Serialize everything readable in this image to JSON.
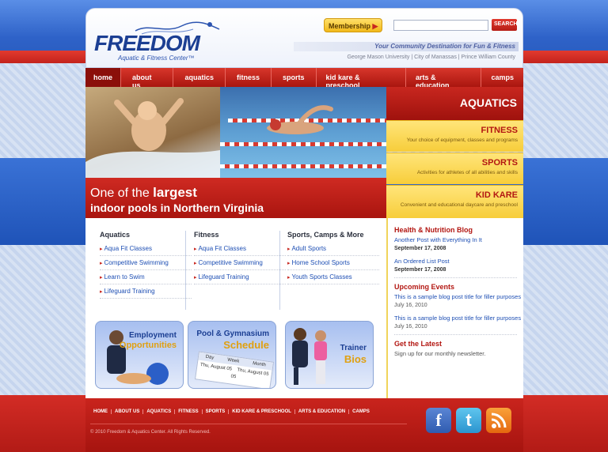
{
  "header": {
    "logo_text": "FREEDOM",
    "logo_subtitle": "Aquatic & Fitness Center™",
    "membership_label": "Membership",
    "search_placeholder": "",
    "search_button": "SEARCH",
    "tagline": "Your Community Destination for Fun & Fitness",
    "locations": "George Mason University | City of Manassas | Prince William County"
  },
  "nav": {
    "items": [
      "home",
      "about us",
      "aquatics",
      "fitness",
      "sports",
      "kid kare & preschool",
      "arts & education",
      "camps"
    ]
  },
  "hero": {
    "line1_prefix": "One of the ",
    "line1_bold": "largest",
    "line2": "indoor pools in Northern Virginia"
  },
  "promos": {
    "aquatics": "AQUATICS",
    "items": [
      {
        "title": "FITNESS",
        "desc": "Your choice of equipment, classes and programs"
      },
      {
        "title": "SPORTS",
        "desc": "Activities for athletes of all abilities and skills"
      },
      {
        "title": "KID KARE",
        "desc": "Convenient and educational daycare and preschool"
      }
    ]
  },
  "columns": [
    {
      "title": "Aquatics",
      "links": [
        "Aqua Fit Classes",
        "Competitive Swimming",
        "Learn to Swim",
        "Lifeguard Training"
      ]
    },
    {
      "title": "Fitness",
      "links": [
        "Aqua Fit Classes",
        "Competitive Swimming",
        "Lifeguard Training"
      ]
    },
    {
      "title": "Sports, Camps & More",
      "links": [
        "Adult Sports",
        "Home School Sports",
        "Youth Sports Classes"
      ]
    }
  ],
  "tiles": {
    "employment": {
      "title": "Employment",
      "sub": "Opportunities"
    },
    "schedule": {
      "title": "Pool & Gymnasium",
      "sub": "Schedule",
      "cal_day": "Day",
      "cal_week": "Week",
      "cal_month": "Month",
      "cal_date1": "Thu, August 05",
      "cal_date2": "Thu, August 05",
      "cal_num": "05"
    },
    "trainer": {
      "title": "Trainer",
      "sub": "Bios"
    }
  },
  "sidebar": {
    "blog_title": "Health & Nutrition Blog",
    "posts": [
      {
        "title": "Another Post with Everything In It",
        "date": "September 17, 2008"
      },
      {
        "title": "An Ordered List Post",
        "date": "September 17, 2008"
      }
    ],
    "events_title": "Upcoming Events",
    "events": [
      {
        "title": "This is a sample blog post title for filler purposes",
        "date": "July 16, 2010"
      },
      {
        "title": "This is a sample blog post title for filler purposes",
        "date": "July 16, 2010"
      }
    ],
    "latest_title": "Get the Latest",
    "latest_text": "Sign up for our monthly newsletter."
  },
  "footer": {
    "links": [
      "HOME",
      "ABOUT US",
      "AQUATICS",
      "FITNESS",
      "SPORTS",
      "KID KARE & PRESCHOOL",
      "ARTS & EDUCATION",
      "CAMPS"
    ],
    "copyright": "© 2010 Freedom & Aquatics Center. All Rights Reserved.",
    "social": {
      "facebook": "f",
      "twitter": "t"
    }
  },
  "colors": {
    "brand_red": "#c8271f",
    "brand_blue": "#1c3f93",
    "promo_yellow": "#f7cd3a"
  }
}
